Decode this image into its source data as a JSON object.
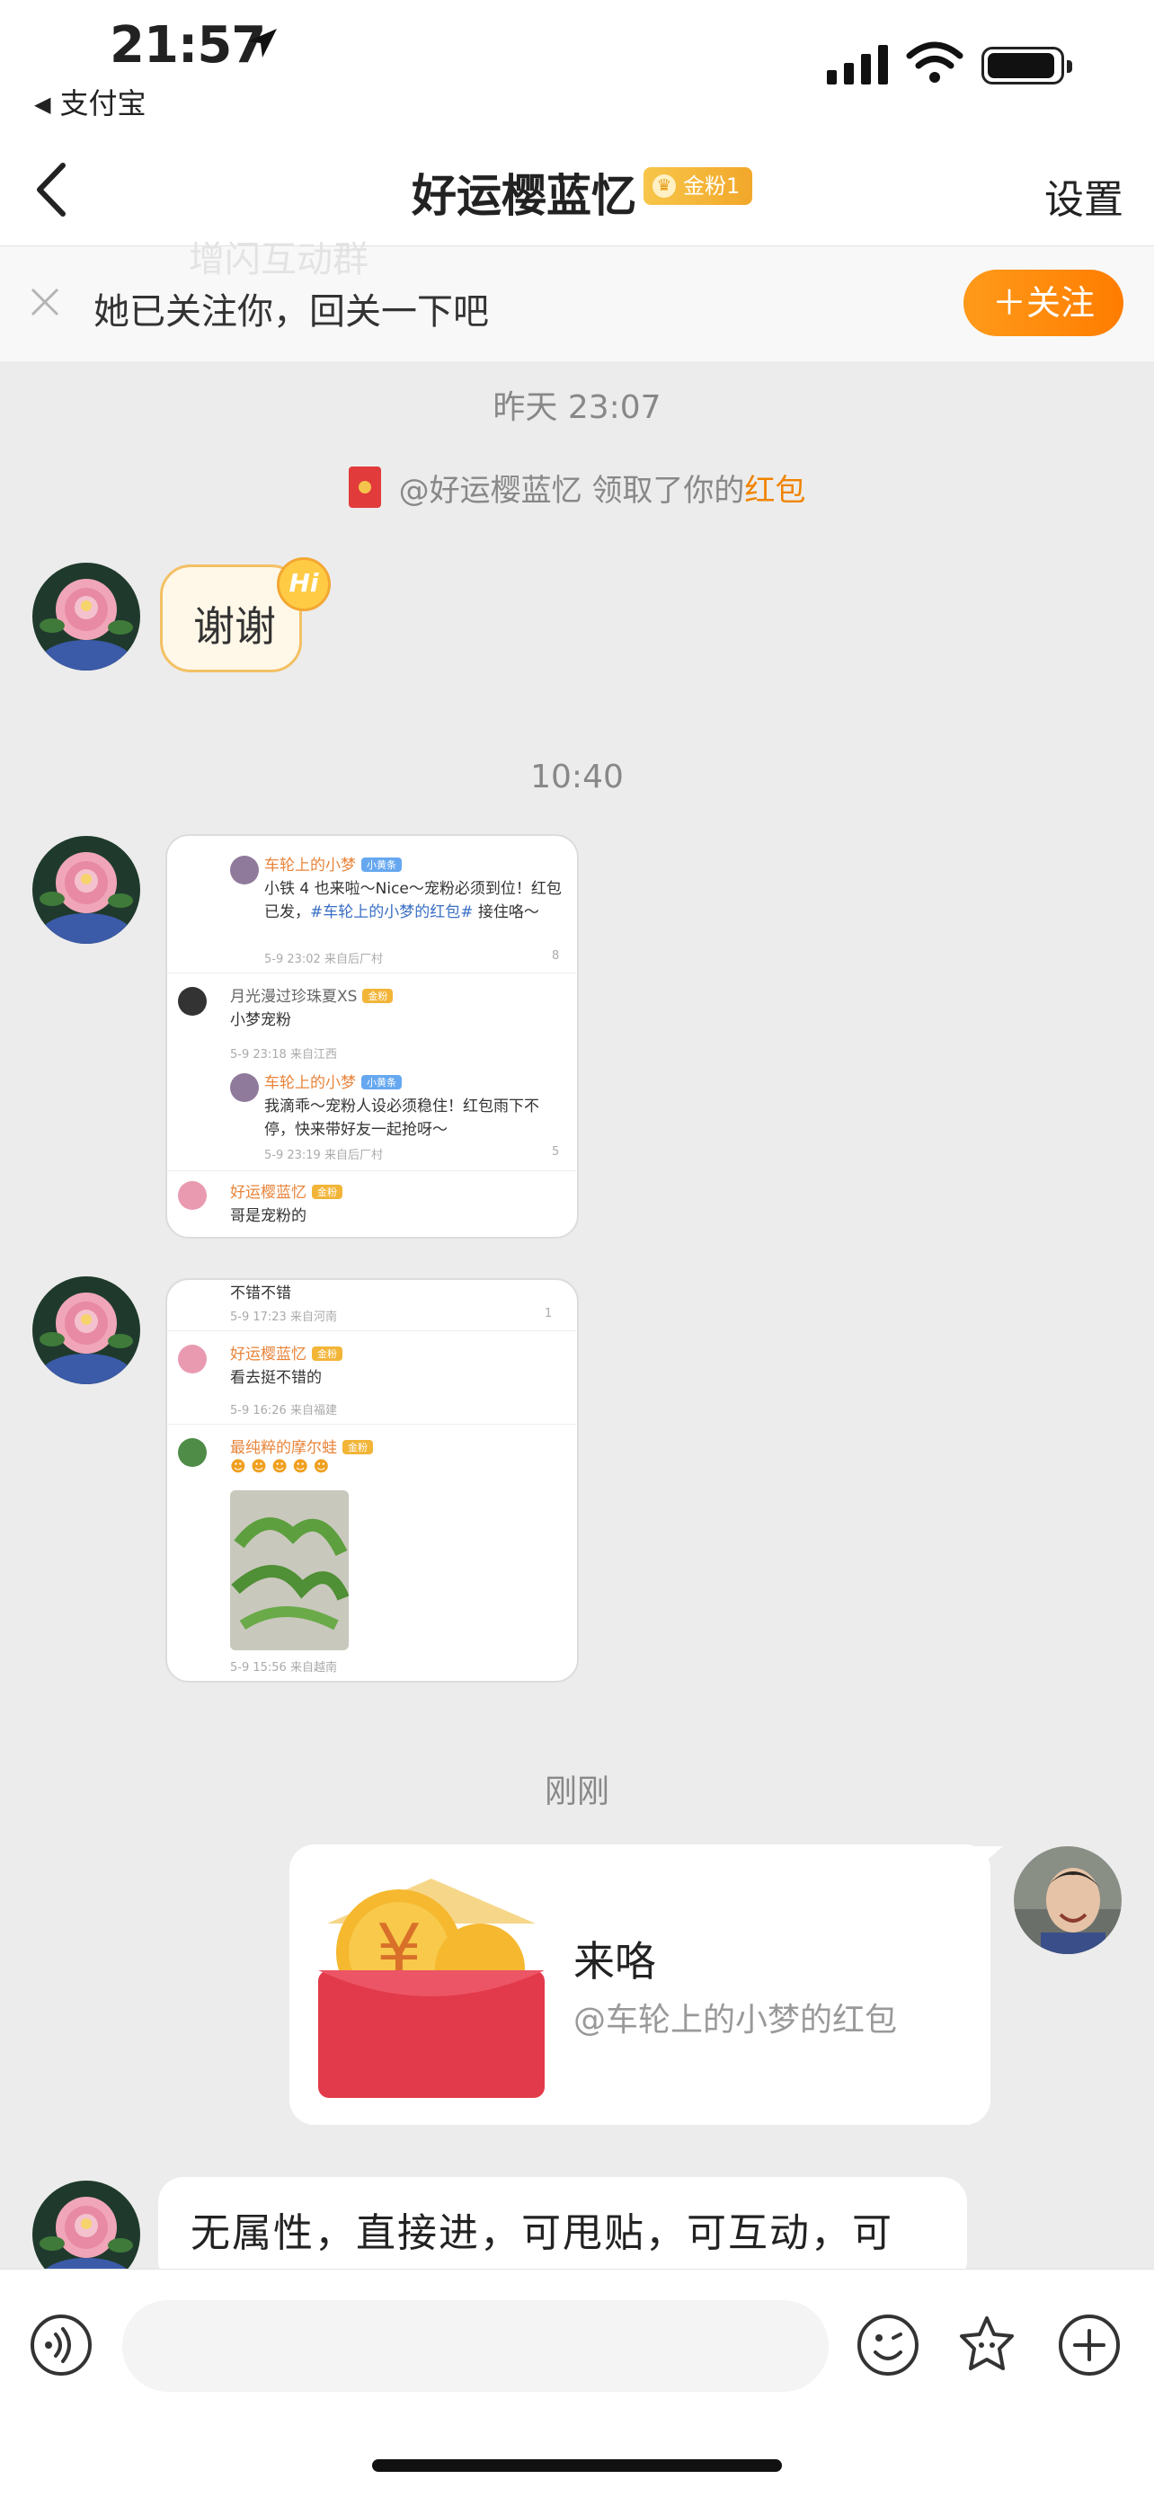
{
  "status_bar": {
    "time": "21:57",
    "back_app": "支付宝"
  },
  "nav": {
    "title": "好运樱蓝忆",
    "badge": "金粉1",
    "settings": "设置"
  },
  "follow_banner": {
    "ghost_text": "增闪互动群",
    "text": "她已关注你，回关一下吧",
    "button": "＋关注"
  },
  "messages": {
    "ts1": "昨天 23:07",
    "sys_pre": "@好运樱蓝忆 领取了你的",
    "sys_hl": "红包",
    "thanks": "谢谢",
    "hi": "Hi",
    "ts2": "10:40",
    "ts3": "刚刚",
    "redpacket": {
      "title": "来咯",
      "subtitle": "@车轮上的小梦的红包"
    },
    "last_text": "无属性，直接进，可甩贴，可互动，可"
  },
  "shot1": {
    "n1": "车轮上的小梦",
    "n1_tag": "小黄条",
    "c1a": "小铁 4 也来啦～Nice～宠粉必须到位！红包",
    "c1b": "已发，",
    "c1_link": "#车轮上的小梦的红包#",
    "c1c": " 接住咯～",
    "m1": "5-9 23:02  来自后厂村",
    "l1": "8",
    "n2": "月光漫过珍珠夏XS",
    "n2_tag": "金粉",
    "c2": "小梦宠粉",
    "m2": "5-9 23:18  来自江西",
    "n3": "车轮上的小梦",
    "n3_tag": "小黄条",
    "c3a": "我滴乖～宠粉人设必须稳住！红包雨下不",
    "c3b": "停，快来带好友一起抢呀～",
    "m3": "5-9 23:19  来自后厂村",
    "l3": "5",
    "n4": "好运樱蓝忆",
    "n4_tag": "金粉",
    "c4": "哥是宠粉的"
  },
  "shot2": {
    "c0": "不错不错",
    "m0": "5-9 17:23  来自河南",
    "l0": "1",
    "n1": "好运樱蓝忆",
    "n1_tag": "金粉",
    "c1": "看去挺不错的",
    "m1": "5-9 16:26  来自福建",
    "n2": "最纯粹的摩尔蛙",
    "n2_tag": "金粉",
    "m2": "5-9 15:56  来自越南"
  },
  "colors": {
    "accent": "#ff8a00",
    "bubble_gold": "#f3c063",
    "red_packet": "#e23a4a"
  }
}
